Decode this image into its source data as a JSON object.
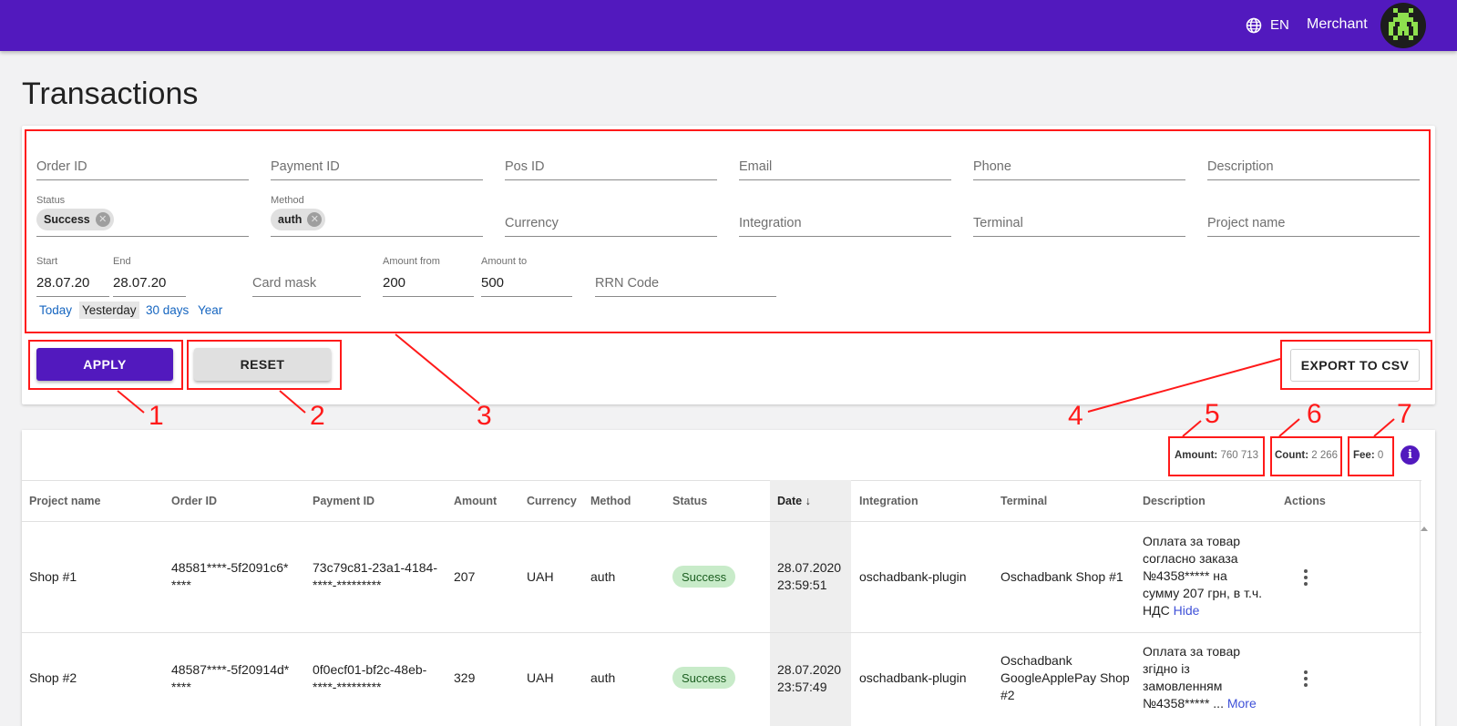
{
  "header": {
    "language": "EN",
    "user_name": "Merchant"
  },
  "page_title": "Transactions",
  "filters": {
    "order_id": "Order ID",
    "payment_id": "Payment ID",
    "pos_id": "Pos ID",
    "email": "Email",
    "phone": "Phone",
    "description": "Description",
    "status_label": "Status",
    "status_chip": "Success",
    "method_label": "Method",
    "method_chip": "auth",
    "currency": "Currency",
    "integration": "Integration",
    "terminal": "Terminal",
    "project_name": "Project name",
    "start_label": "Start",
    "start_value": "28.07.20",
    "end_label": "End",
    "end_value": "28.07.20",
    "card_mask": "Card mask",
    "amount_from_label": "Amount from",
    "amount_from_value": "200",
    "amount_to_label": "Amount to",
    "amount_to_value": "500",
    "rrn_code": "RRN Code",
    "quick_ranges": [
      "Today",
      "Yesterday",
      "30 days",
      "Year"
    ],
    "active_quick_range": "Yesterday"
  },
  "buttons": {
    "apply": "APPLY",
    "reset": "RESET",
    "export": "EXPORT TO CSV"
  },
  "summary": {
    "amount_label": "Amount:",
    "amount_value": "760 713",
    "count_label": "Count:",
    "count_value": "2 266",
    "fee_label": "Fee:",
    "fee_value": "0"
  },
  "table": {
    "columns": [
      "Project name",
      "Order ID",
      "Payment ID",
      "Amount",
      "Currency",
      "Method",
      "Status",
      "Date",
      "Integration",
      "Terminal",
      "Description",
      "Actions"
    ],
    "sorted_column": "Date",
    "rows": [
      {
        "project": "Shop #1",
        "order_id_1": "48581****-5f2091c6*",
        "order_id_2": "****",
        "payment_id_1": "73c79c81-23a1-4184-",
        "payment_id_2": "****-*********",
        "amount": "207",
        "currency": "UAH",
        "method": "auth",
        "status": "Success",
        "date_1": "28.07.2020",
        "date_2": "23:59:51",
        "integration": "oschadbank-plugin",
        "terminal": "Oschadbank Shop #1",
        "desc_lines": [
          "Оплата за товар",
          "согласно заказа",
          "№4358***** на",
          "сумму 207 грн, в т.ч.",
          "НДС"
        ],
        "desc_link": "Hide"
      },
      {
        "project": "Shop #2",
        "order_id_1": "48587****-5f20914d*",
        "order_id_2": "****",
        "payment_id_1": "0f0ecf01-bf2c-48eb-",
        "payment_id_2": "****-*********",
        "amount": "329",
        "currency": "UAH",
        "method": "auth",
        "status": "Success",
        "date_1": "28.07.2020",
        "date_2": "23:57:49",
        "integration": "oschadbank-plugin",
        "terminal_lines": [
          "Oschadbank",
          "GoogleApplePay Shop",
          "#2"
        ],
        "desc_lines": [
          "Оплата за товар",
          "згідно із",
          "замовленням",
          "№4358***** ..."
        ],
        "desc_link": "More"
      }
    ]
  },
  "annotations": [
    "1",
    "2",
    "3",
    "4",
    "5",
    "6",
    "7"
  ],
  "colors": {
    "primary": "#5219be",
    "annotation": "#ff1a1a",
    "success_bg": "#c8ebc9",
    "link": "#1565c0"
  }
}
